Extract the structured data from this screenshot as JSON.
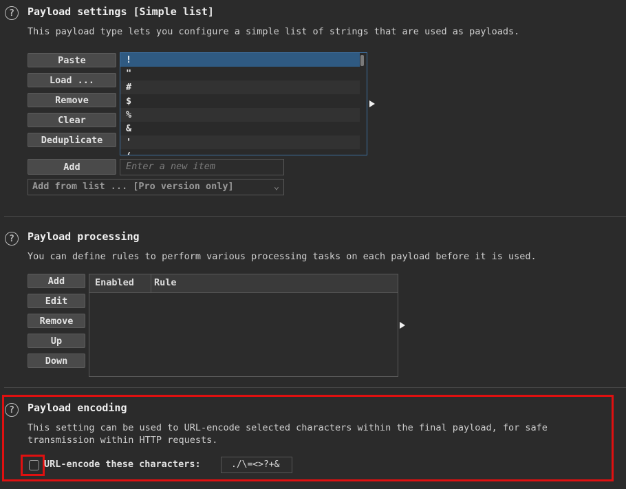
{
  "settings": {
    "title": "Payload settings [Simple list]",
    "description": "This payload type lets you configure a simple list of strings that are used as payloads.",
    "buttons": {
      "paste": "Paste",
      "load": "Load ...",
      "remove": "Remove",
      "clear": "Clear",
      "deduplicate": "Deduplicate",
      "add": "Add"
    },
    "list_items": [
      "!",
      "\"",
      "#",
      "$",
      "%",
      "&",
      "'",
      "("
    ],
    "add_placeholder": "Enter a new item",
    "add_from_list": "Add from list ... [Pro version only]"
  },
  "processing": {
    "title": "Payload processing",
    "description": "You can define rules to perform various processing tasks on each payload before it is used.",
    "buttons": {
      "add": "Add",
      "edit": "Edit",
      "remove": "Remove",
      "up": "Up",
      "down": "Down"
    },
    "columns": [
      "Enabled",
      "Rule"
    ]
  },
  "encoding": {
    "title": "Payload encoding",
    "description_line1": "This setting can be used to URL-encode selected characters within the final payload, for safe",
    "description_line2": "transmission within HTTP requests.",
    "checkbox_label": "URL-encode these characters:",
    "checkbox_checked": false,
    "characters": "./\\=<>?+&"
  },
  "icons": {
    "help": "?"
  },
  "colors": {
    "background": "#2b2b2b",
    "selection": "#2f5a82",
    "highlight": "#e01010"
  }
}
